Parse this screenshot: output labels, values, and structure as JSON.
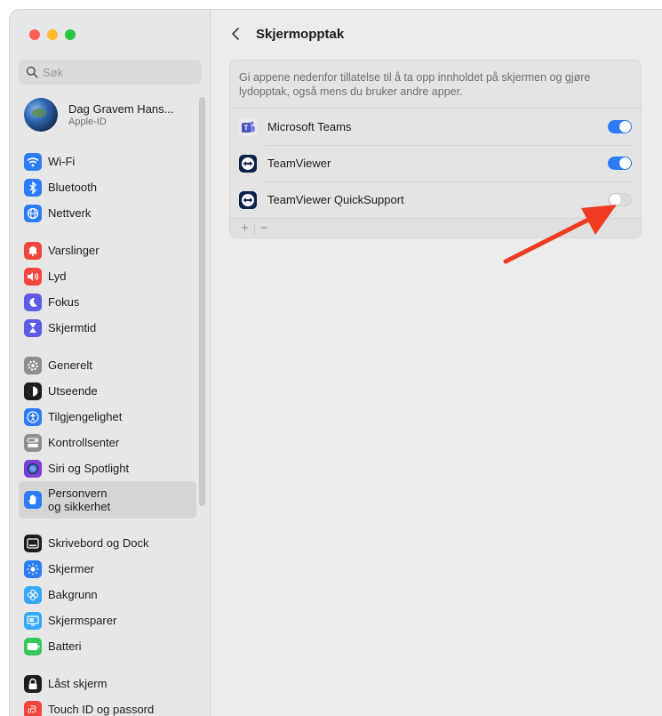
{
  "search": {
    "placeholder": "Søk"
  },
  "account": {
    "name": "Dag Gravem Hans...",
    "subtitle": "Apple-ID"
  },
  "sidebar": {
    "groups": [
      [
        {
          "label": "Wi-Fi",
          "icon": "wifi-icon",
          "color": "#2b7cf6"
        },
        {
          "label": "Bluetooth",
          "icon": "bluetooth-icon",
          "color": "#2b7cf6"
        },
        {
          "label": "Nettverk",
          "icon": "globe-icon",
          "color": "#2b7cf6"
        }
      ],
      [
        {
          "label": "Varslinger",
          "icon": "bell-icon",
          "color": "#f2453d"
        },
        {
          "label": "Lyd",
          "icon": "speaker-icon",
          "color": "#f2453d"
        },
        {
          "label": "Fokus",
          "icon": "moon-icon",
          "color": "#5e5ce6"
        },
        {
          "label": "Skjermtid",
          "icon": "hourglass-icon",
          "color": "#5e5ce6"
        }
      ],
      [
        {
          "label": "Generelt",
          "icon": "gear-icon",
          "color": "#8e8e93"
        },
        {
          "label": "Utseende",
          "icon": "appearance-icon",
          "color": "#1d1d1f"
        },
        {
          "label": "Tilgjengelighet",
          "icon": "accessibility-icon",
          "color": "#2b7cf6"
        },
        {
          "label": "Kontrollsenter",
          "icon": "control-center-icon",
          "color": "#8e8e93"
        },
        {
          "label": "Siri og Spotlight",
          "icon": "siri-icon",
          "color": "#7a3fd6"
        },
        {
          "label": "Personvern\nog sikkerhet",
          "icon": "hand-icon",
          "color": "#2b7cf6",
          "selected": true
        }
      ],
      [
        {
          "label": "Skrivebord og Dock",
          "icon": "dock-icon",
          "color": "#1d1d1f"
        },
        {
          "label": "Skjermer",
          "icon": "display-icon",
          "color": "#2b7cf6"
        },
        {
          "label": "Bakgrunn",
          "icon": "wallpaper-icon",
          "color": "#39a9f5"
        },
        {
          "label": "Skjermsparer",
          "icon": "screensaver-icon",
          "color": "#39a9f5"
        },
        {
          "label": "Batteri",
          "icon": "battery-icon",
          "color": "#34c759"
        }
      ],
      [
        {
          "label": "Låst skjerm",
          "icon": "lock-icon",
          "color": "#1d1d1f"
        },
        {
          "label": "Touch ID og passord",
          "icon": "fingerprint-icon",
          "color": "#f2453d"
        }
      ]
    ]
  },
  "main": {
    "title": "Skjermopptak",
    "description": "Gi appene nedenfor tillatelse til å ta opp innholdet på skjermen og gjøre lydopptak, også mens du bruker andre apper.",
    "apps": [
      {
        "name": "Microsoft Teams",
        "icon": "teams-icon",
        "enabled": true
      },
      {
        "name": "TeamViewer",
        "icon": "teamviewer-icon",
        "enabled": true
      },
      {
        "name": "TeamViewer QuickSupport",
        "icon": "teamviewer-icon",
        "enabled": false
      }
    ],
    "footer": {
      "add": "+",
      "remove": "−"
    }
  },
  "colors": {
    "accent": "#2b7cf6",
    "annotation_arrow": "#f03a22"
  }
}
